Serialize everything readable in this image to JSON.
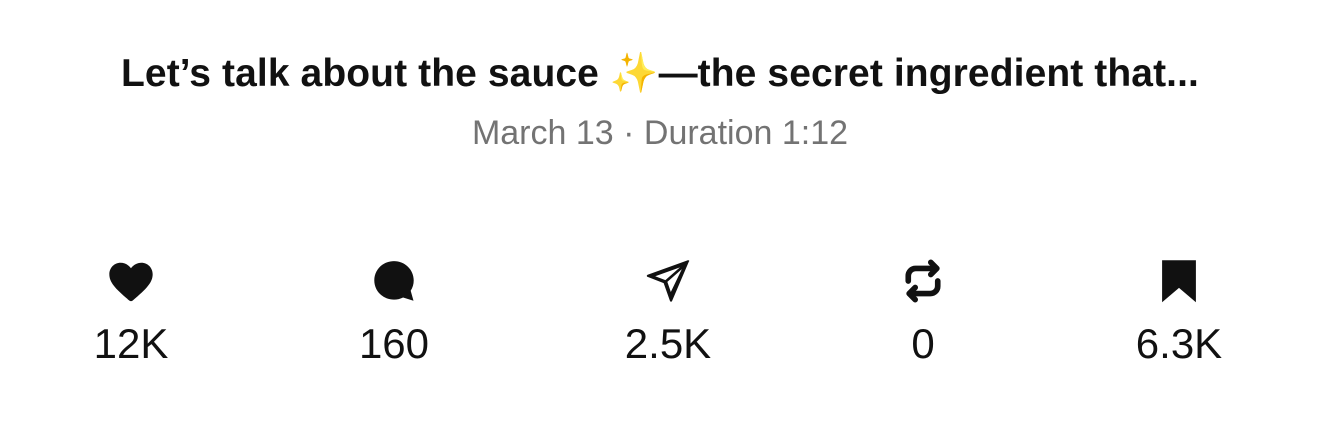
{
  "post": {
    "title_before": "Let’s talk about the sauce ",
    "title_emoji": "✨",
    "title_after": "—the secret ingredient that...",
    "meta": "March 13 · Duration 1:12"
  },
  "stats": {
    "likes": {
      "icon": "heart-icon",
      "count": "12K"
    },
    "comments": {
      "icon": "comment-bubble-icon",
      "count": "160"
    },
    "shares": {
      "icon": "send-icon",
      "count": "2.5K"
    },
    "reposts": {
      "icon": "repost-icon",
      "count": "0"
    },
    "saves": {
      "icon": "bookmark-icon",
      "count": "6.3K"
    }
  },
  "colors": {
    "text": "#111111",
    "meta_text": "#737373",
    "sparkle": "#f2c94c",
    "background": "#ffffff"
  }
}
